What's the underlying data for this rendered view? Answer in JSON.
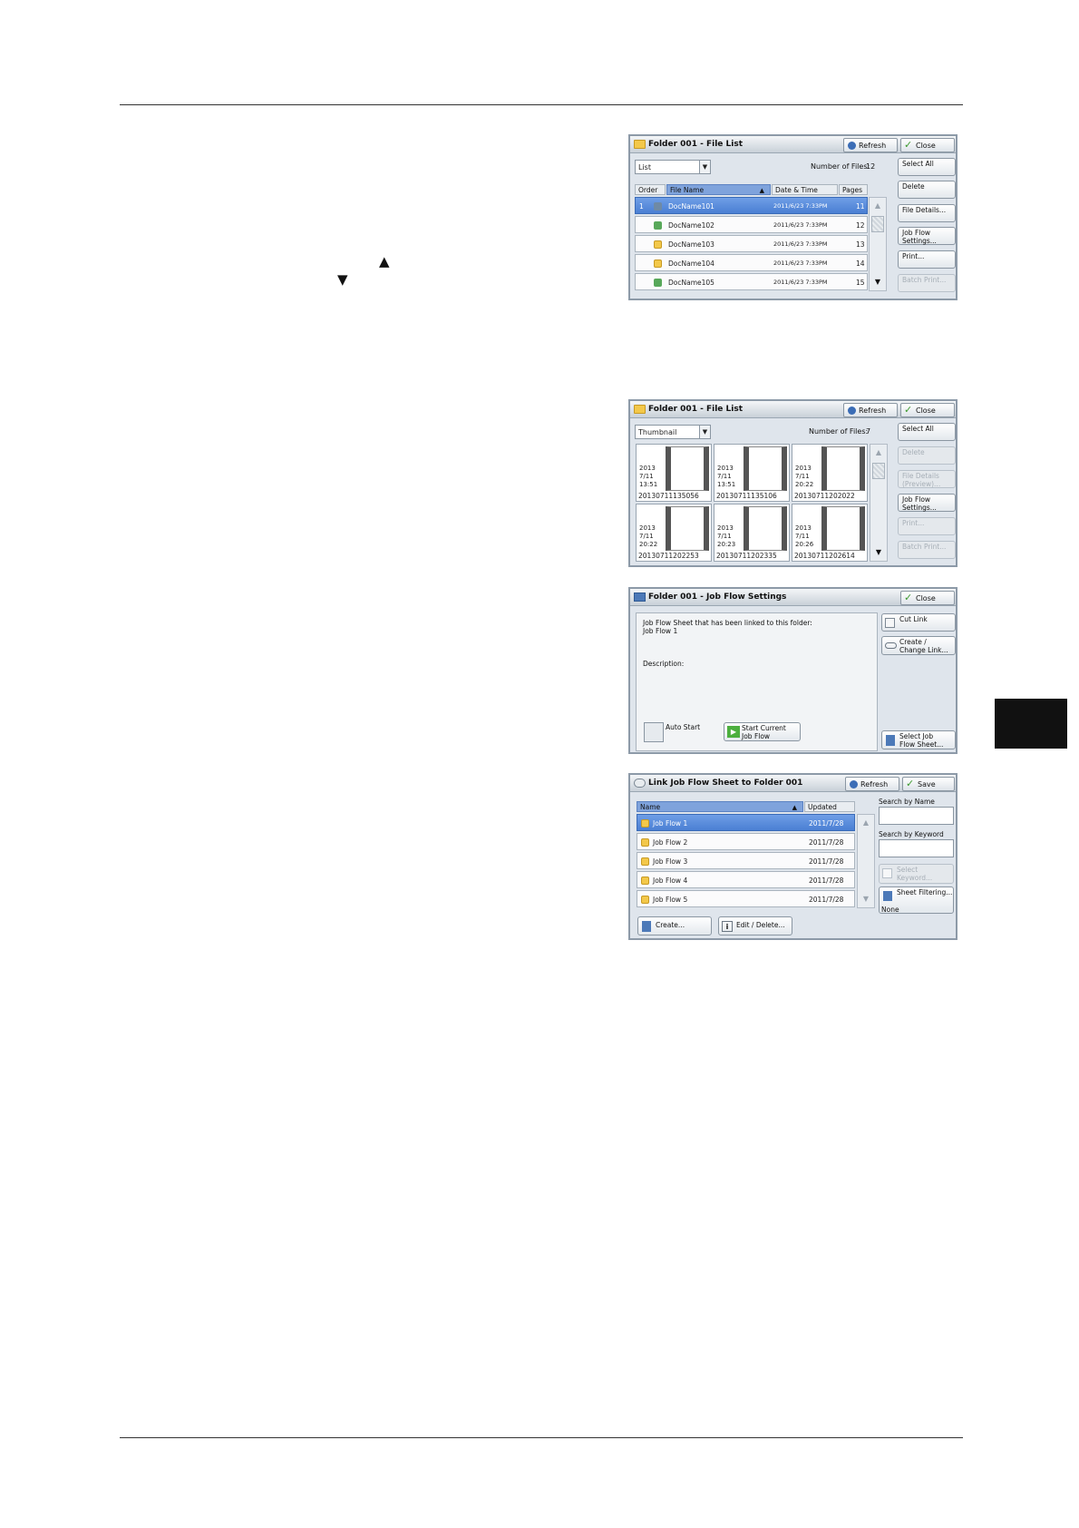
{
  "page": {
    "arrows": {
      "up": "▲",
      "down": "▼"
    }
  },
  "file_list": {
    "title": "Folder 001 - File List",
    "refresh": "Refresh",
    "close": "Close",
    "view_mode": "List",
    "num_files_label": "Number of Files:",
    "num_files": "12",
    "columns": {
      "order": "Order",
      "file_name": "File Name",
      "date_time": "Date & Time",
      "pages": "Pages"
    },
    "rows": [
      {
        "order": "1",
        "name": "DocName101",
        "date": "2011/6/23 7:33PM",
        "pages": "11"
      },
      {
        "order": "",
        "name": "DocName102",
        "date": "2011/6/23 7:33PM",
        "pages": "12"
      },
      {
        "order": "",
        "name": "DocName103",
        "date": "2011/6/23 7:33PM",
        "pages": "13"
      },
      {
        "order": "",
        "name": "DocName104",
        "date": "2011/6/23 7:33PM",
        "pages": "14"
      },
      {
        "order": "",
        "name": "DocName105",
        "date": "2011/6/23 7:33PM",
        "pages": "15"
      }
    ],
    "side": {
      "select_all": "Select All",
      "delete": "Delete",
      "file_details": "File Details...",
      "job_flow": "Job Flow\nSettings...",
      "print": "Print...",
      "batch_print": "Batch Print..."
    }
  },
  "thumb_list": {
    "title": "Folder 001 - File List",
    "refresh": "Refresh",
    "close": "Close",
    "view_mode": "Thumbnail",
    "num_files_label": "Number of Files:",
    "num_files": "7",
    "thumbs": [
      {
        "date": "2013\n7/11\n13:51",
        "name": "20130711135056"
      },
      {
        "date": "2013\n7/11\n13:51",
        "name": "20130711135106"
      },
      {
        "date": "2013\n7/11\n20:22",
        "name": "20130711202022"
      },
      {
        "date": "2013\n7/11\n20:22",
        "name": "20130711202253"
      },
      {
        "date": "2013\n7/11\n20:23",
        "name": "20130711202335"
      },
      {
        "date": "2013\n7/11\n20:26",
        "name": "20130711202614"
      }
    ],
    "side": {
      "select_all": "Select All",
      "delete": "Delete",
      "file_details": "File Details\n(Preview)...",
      "job_flow": "Job Flow\nSettings...",
      "print": "Print...",
      "batch_print": "Batch Print..."
    }
  },
  "job_flow_settings": {
    "title": "Folder 001 - Job Flow Settings",
    "close": "Close",
    "linked_label": "Job Flow Sheet that has been linked to this folder:",
    "linked_value": "Job Flow 1",
    "description_label": "Description:",
    "auto_start": "Auto Start",
    "start_current": "Start Current\nJob Flow",
    "cut_link": "Cut Link",
    "create_change": "Create /\nChange Link...",
    "select_sheet": "Select Job\nFlow Sheet..."
  },
  "link_sheet": {
    "title": "Link Job Flow Sheet to Folder 001",
    "refresh": "Refresh",
    "save": "Save",
    "columns": {
      "name": "Name",
      "updated": "Updated"
    },
    "rows": [
      {
        "name": "Job Flow 1",
        "updated": "2011/7/28"
      },
      {
        "name": "Job Flow 2",
        "updated": "2011/7/28"
      },
      {
        "name": "Job Flow 3",
        "updated": "2011/7/28"
      },
      {
        "name": "Job Flow 4",
        "updated": "2011/7/28"
      },
      {
        "name": "Job Flow 5",
        "updated": "2011/7/28"
      }
    ],
    "search_name": "Search by Name",
    "search_keyword": "Search by Keyword",
    "select_keyword": "Select\nKeyword...",
    "sheet_filtering": "Sheet Filtering...",
    "filter_value": "None",
    "create": "Create...",
    "edit_delete": "Edit / Delete..."
  }
}
